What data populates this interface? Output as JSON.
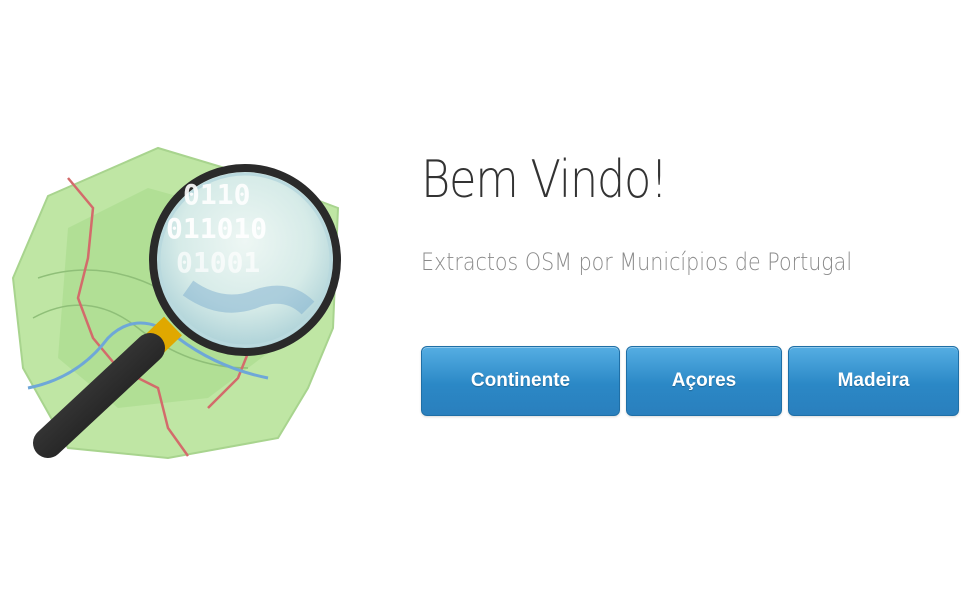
{
  "hero": {
    "title": "Bem Vindo!",
    "subtitle": "Extractos OSM por Municípios de Portugal"
  },
  "buttons": {
    "continente": "Continente",
    "acores": "Açores",
    "madeira": "Madeira"
  },
  "logo": {
    "icon": "openstreetmap-magnifier-logo",
    "digits_line1": "0110",
    "digits_line2": "011010",
    "digits_line3": "01001"
  },
  "colors": {
    "button": "#2b88c6",
    "title": "#333333",
    "subtitle": "#8a8a8a",
    "map_green": "#bde3a2"
  }
}
